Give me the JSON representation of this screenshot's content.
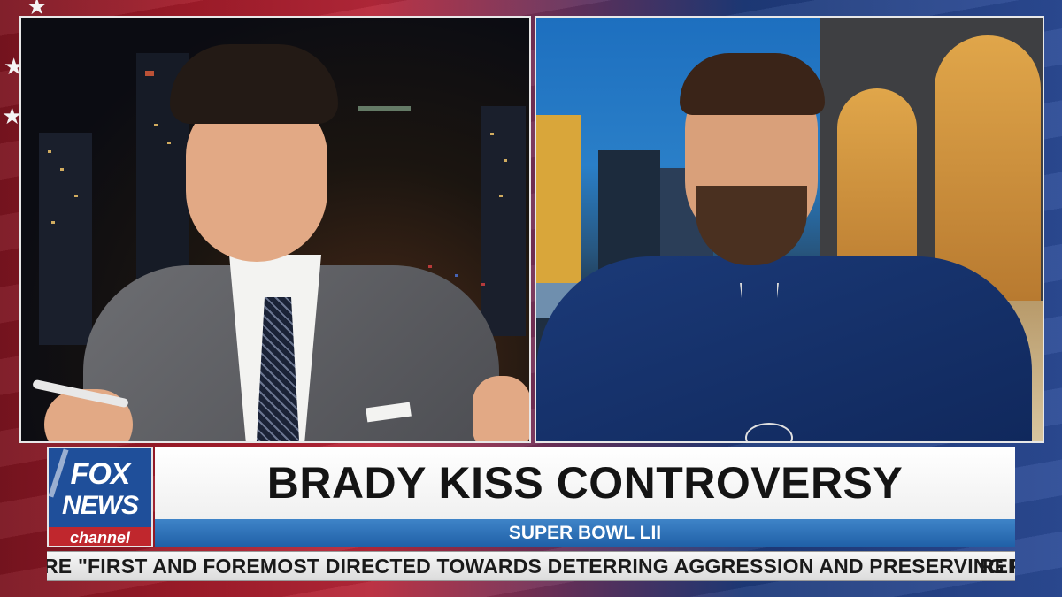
{
  "broadcast": {
    "network_logo": {
      "line1": "FOX",
      "line2": "NEWS",
      "line3": "channel"
    },
    "headline": "BRADY KISS CONTROVERSY",
    "subheadline": "SUPER BOWL LII",
    "ticker": "RE \"FIRST AND FOREMOST DIRECTED TOWARDS DETERRING AGGRESSION AND PRESERVING PEACE\"...",
    "ticker_next": "REP"
  },
  "colors": {
    "fox_blue": "#1f4f9a",
    "fox_red": "#c0272d",
    "subhead_blue": "#1f5fa6",
    "headline_text": "#141414"
  },
  "icons": {
    "background": "american-flag",
    "left_panel": "host-in-studio",
    "right_panel": "guest-remote-bridge"
  }
}
